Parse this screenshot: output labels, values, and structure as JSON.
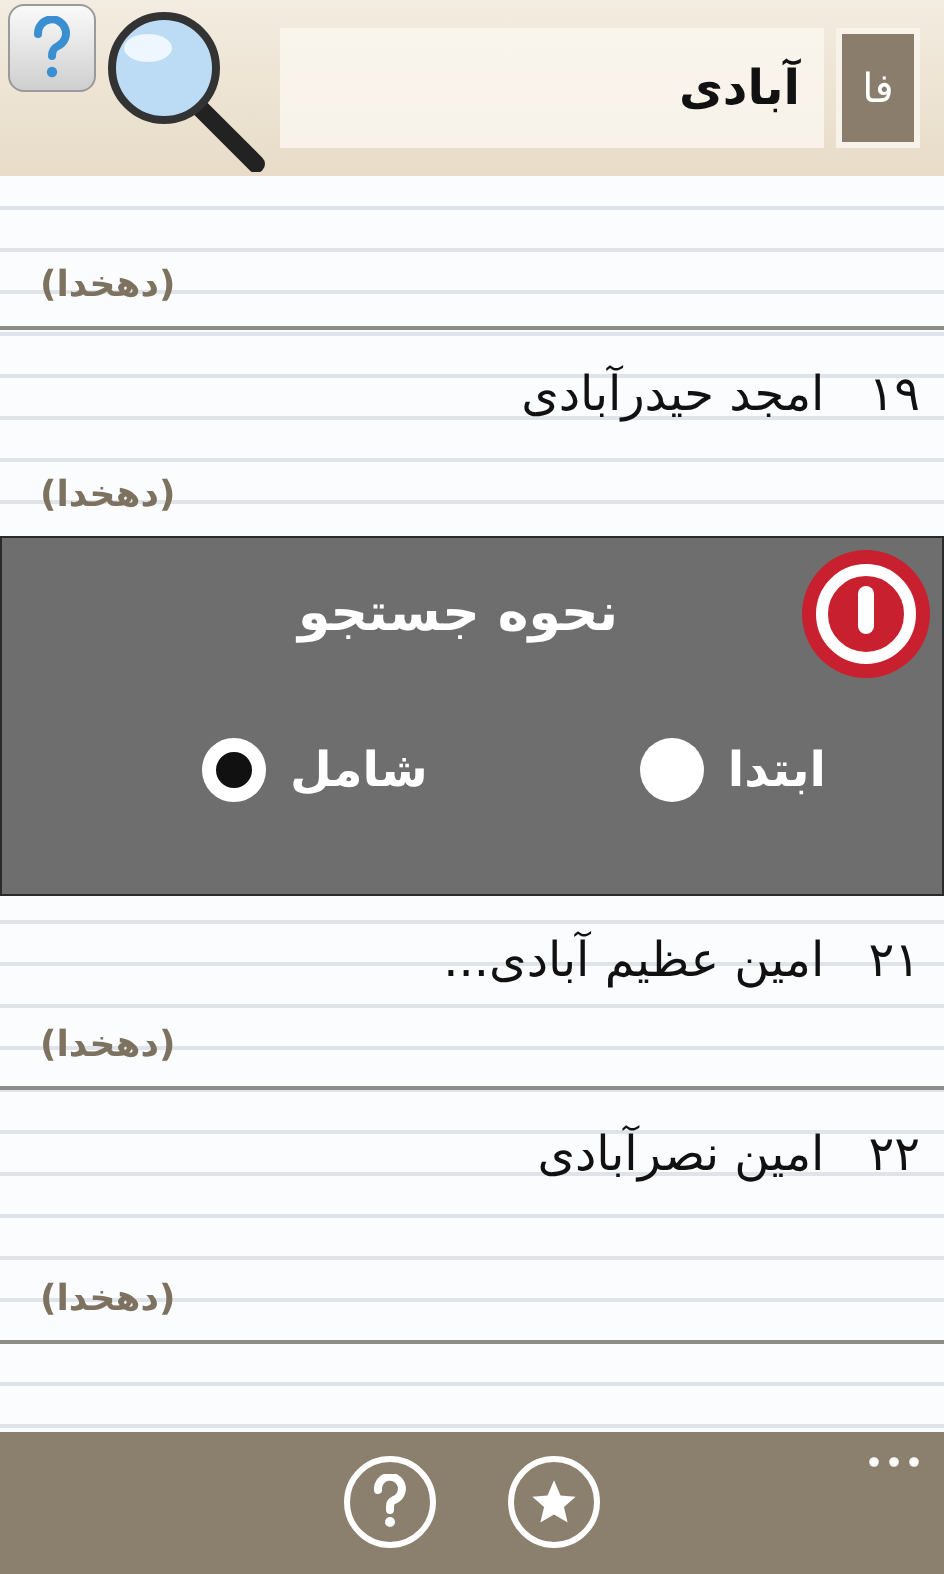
{
  "header": {
    "search_value": "آبادی",
    "language_label": "فا"
  },
  "rows": [
    {
      "source": "(دهخدا)"
    },
    {
      "number": "۱۹",
      "title": "امجد حیدرآبادی",
      "source": "(دهخدا)"
    }
  ],
  "dialog": {
    "title": "نحوه جستجو",
    "options": [
      {
        "label": "ابتدا",
        "selected": false
      },
      {
        "label": "شامل",
        "selected": true
      }
    ]
  },
  "rows_below": [
    {
      "number": "۲۱",
      "title": "امین عظیم آبادی...",
      "source": "(دهخدا)"
    },
    {
      "number": "۲۲",
      "title": "امین نصرآبادی",
      "source": "(دهخدا)"
    }
  ]
}
